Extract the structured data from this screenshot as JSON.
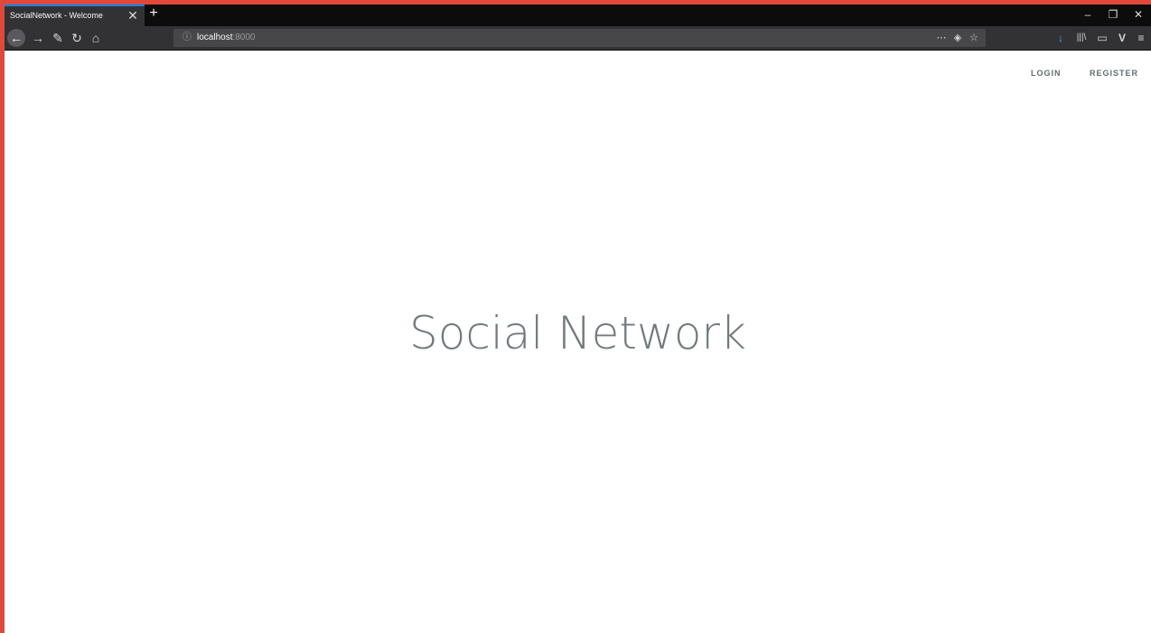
{
  "browser": {
    "tab": {
      "title": "SocialNetwork - Welcome",
      "close": "✕"
    },
    "new_tab": "+",
    "window_controls": {
      "minimize": "–",
      "restore": "❐",
      "close": "✕"
    },
    "nav": {
      "back": "←",
      "forward": "→",
      "tools": "✎",
      "reload": "↻",
      "home": "⌂"
    },
    "urlbar": {
      "info": "ⓘ",
      "host": "localhost",
      "port": ":8000",
      "more": "⋯",
      "pocket": "◈",
      "bookmark": "☆"
    },
    "toolbar": {
      "downloads": "↓",
      "library": "|||\\",
      "sidebar": "▭",
      "vivaldi": "V",
      "menu": "≡"
    },
    "accent_color": "#0a84ff",
    "frame_color": "#e0493a"
  },
  "page": {
    "nav": {
      "login": "LOGIN",
      "register": "REGISTER"
    },
    "title": "Social Network"
  }
}
